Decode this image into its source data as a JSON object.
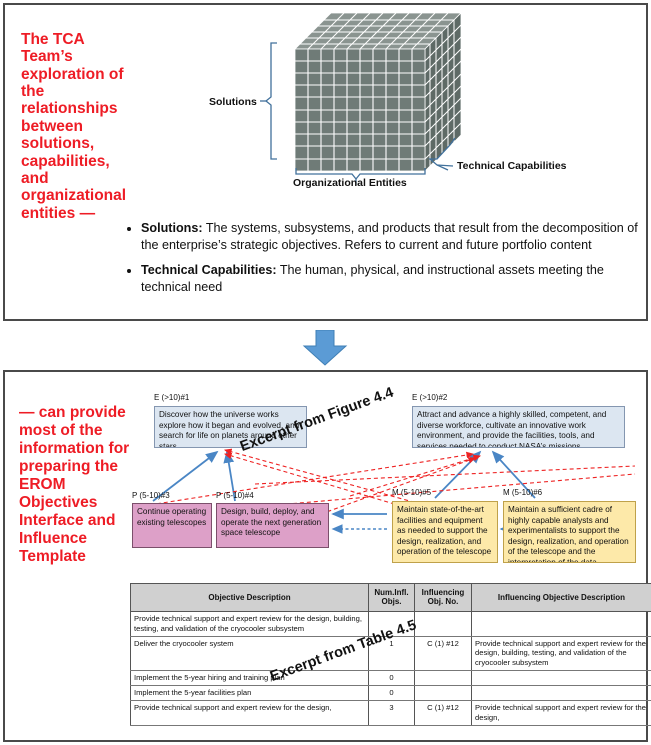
{
  "top_panel": {
    "headline": "The TCA Team’s exploration of the relationships between solutions, capabilities, and organizational entities —",
    "cube": {
      "label_solutions": "Solutions",
      "label_org_entities": "Organizational Entities",
      "label_tech_capabilities": "Technical Capabilities",
      "face_color": "#6f7b77",
      "gridline_color": "#ffffff"
    },
    "bullets": [
      {
        "term": "Solutions:",
        "text": " The systems, subsystems, and products that result from the decomposition of the enterprise’s strategic objectives.  Refers to current and future portfolio content"
      },
      {
        "term": "Technical Capabilities:",
        "text": " The human, physical, and instructional assets meeting the technical need"
      }
    ]
  },
  "flow_arrow": {
    "direction": "down",
    "color": "#5b9bd5"
  },
  "bottom_panel": {
    "headline": "— can provide most of the information for preparing the  EROM Objectives Interface and Influence Template",
    "watermark_figure": "Excerpt from Figure 4.4",
    "watermark_table": "Excerpt from Table 4.5",
    "diagram": {
      "boxes": [
        {
          "id": "e1",
          "label": "E (>10)#1",
          "color": "#dce6f1",
          "text": "Discover how the universe works explore how it began and evolved, and search for life on planets around other stars"
        },
        {
          "id": "e2",
          "label": "E (>10)#2",
          "color": "#dce6f1",
          "text": "Attract and advance a highly skilled, competent, and diverse workforce, cultivate an innovative work environment, and provide the facilities, tools, and services needed to conduct NASA’s missions"
        },
        {
          "id": "p3",
          "label": "P (5-10)#3",
          "color": "#dda0c8",
          "text": "Continue operating existing telescopes"
        },
        {
          "id": "p4",
          "label": "P (5-10)#4",
          "color": "#dda0c8",
          "text": "Design, build, deploy, and operate the next generation space telescope"
        },
        {
          "id": "m5",
          "label": "M (5-10)#5",
          "color": "#fde9a9",
          "text": "Maintain state-of-the-art facilities and equipment as needed to support the design, realization, and operation of the telescope"
        },
        {
          "id": "m6",
          "label": "M (5-10)#6",
          "color": "#fde9a9",
          "text": "Maintain a sufficient cadre of highly capable analysts and experimentalists to support the design, realization, and operation of the telescope and the interpretation of the data"
        }
      ],
      "arrow_solid_color": "#4a86c5",
      "arrow_dashed_color": "#ee2222"
    },
    "table": {
      "headers": [
        "Objective Description",
        "Num.Infl. Objs.",
        "Influencing Obj. No.",
        "Influencing Objective Description"
      ],
      "rows": [
        {
          "objective": "Provide technical support and expert review for the design, building, testing, and validation of the cryocooler subsystem",
          "num": "",
          "obj_no": "",
          "influencing": ""
        },
        {
          "objective": "Deliver the cryocooler system",
          "num": "1",
          "obj_no": "C (1) #12",
          "influencing": "Provide technical support and expert review for the design, building, testing, and validation of the cryocooler subsystem"
        },
        {
          "objective": "Implement the 5-year hiring and training plan",
          "num": "0",
          "obj_no": "",
          "influencing": ""
        },
        {
          "objective": "Implement the 5-year facilities plan",
          "num": "0",
          "obj_no": "",
          "influencing": ""
        },
        {
          "objective": "Provide technical support and expert review for the design,",
          "num": "3",
          "obj_no": "C (1) #12",
          "influencing": "Provide technical support and expert review for the design,"
        }
      ]
    }
  }
}
